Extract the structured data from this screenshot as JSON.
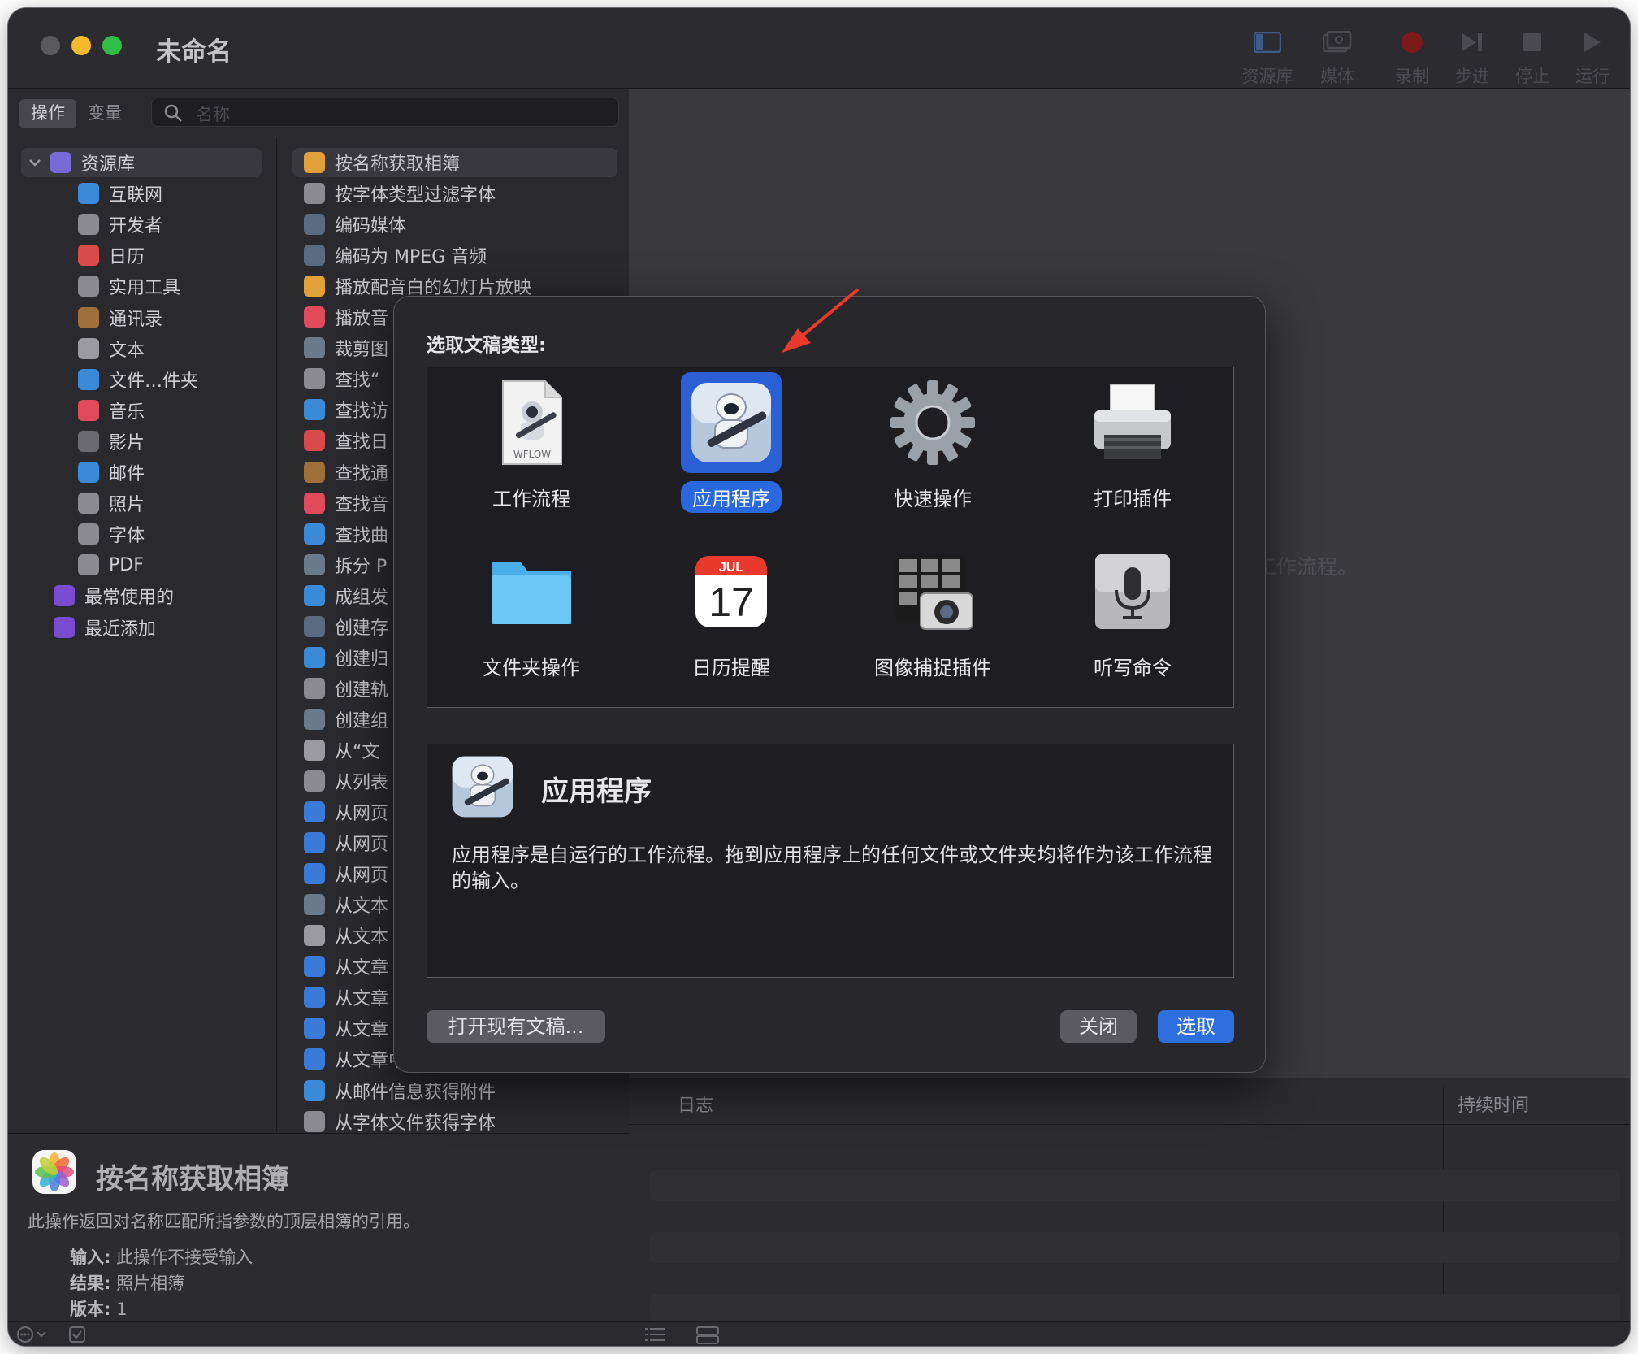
{
  "window": {
    "title": "未命名"
  },
  "toolbar": {
    "buttons": [
      {
        "label": "资源库",
        "icon": "sidebar-icon"
      },
      {
        "label": "媒体",
        "icon": "media-icon"
      },
      {
        "label": "录制",
        "icon": "record-icon"
      },
      {
        "label": "步进",
        "icon": "step-icon"
      },
      {
        "label": "停止",
        "icon": "stop-icon"
      },
      {
        "label": "运行",
        "icon": "play-icon"
      }
    ]
  },
  "library": {
    "segments": [
      "操作",
      "变量"
    ],
    "search_placeholder": "名称",
    "categories": [
      {
        "label": "资源库",
        "icon": "library-icon",
        "color": "#7a6ad8"
      },
      {
        "label": "互联网",
        "icon": "globe-icon",
        "color": "#3a8ad8"
      },
      {
        "label": "开发者",
        "icon": "tools-icon",
        "color": "#8a8a90"
      },
      {
        "label": "日历",
        "icon": "calendar-icon",
        "color": "#d84a4a"
      },
      {
        "label": "实用工具",
        "icon": "utilities-icon",
        "color": "#8a8a90"
      },
      {
        "label": "通讯录",
        "icon": "contacts-icon",
        "color": "#a0703a"
      },
      {
        "label": "文本",
        "icon": "text-icon",
        "color": "#9a9aa0"
      },
      {
        "label": "文件…件夹",
        "icon": "finder-icon",
        "color": "#3a8ad8"
      },
      {
        "label": "音乐",
        "icon": "music-icon",
        "color": "#e04a5a"
      },
      {
        "label": "影片",
        "icon": "movie-icon",
        "color": "#6a6a70"
      },
      {
        "label": "邮件",
        "icon": "mail-icon",
        "color": "#3a8ad8"
      },
      {
        "label": "照片",
        "icon": "photos-icon",
        "color": "#8a8a90"
      },
      {
        "label": "字体",
        "icon": "font-icon",
        "color": "#8a8a90"
      },
      {
        "label": "PDF",
        "icon": "pdf-icon",
        "color": "#8a8a90"
      },
      {
        "label": "最常使用的",
        "icon": "smart-folder-icon",
        "color": "#7a4ad0"
      },
      {
        "label": "最近添加",
        "icon": "smart-folder-icon",
        "color": "#7a4ad0"
      }
    ],
    "actions": [
      "按名称获取相簿",
      "按字体类型过滤字体",
      "编码媒体",
      "编码为 MPEG 音频",
      "播放配音白的幻灯片放映",
      "播放音",
      "裁剪图",
      "查找“",
      "查找访",
      "查找日",
      "查找通",
      "查找音",
      "查找曲",
      "拆分 P",
      "成组发",
      "创建存",
      "创建归",
      "创建轨",
      "创建组",
      "从“文",
      "从列表",
      "从网页",
      "从网页",
      "从网页",
      "从文本",
      "从文本",
      "从文章",
      "从文章",
      "从文章",
      "从文章中获得URL",
      "从邮件信息获得附件",
      "从字体文件获得字体"
    ],
    "action_colors": [
      "#e0a03a",
      "#8a8a90",
      "#5a6a80",
      "#5a6a80",
      "#e0a03a",
      "#e04a5a",
      "#6a7a8a",
      "#8a8a90",
      "#3a8ad8",
      "#d84a4a",
      "#a0703a",
      "#e04a5a",
      "#3a8ad8",
      "#6a7a8a",
      "#3a8ad8",
      "#5a6a80",
      "#3a8ad8",
      "#8a8a90",
      "#6a7a8a",
      "#9a9aa0",
      "#8a8a90",
      "#3a7ad8",
      "#3a7ad8",
      "#3a7ad8",
      "#6a7a8a",
      "#9a9aa0",
      "#3a7ad8",
      "#3a7ad8",
      "#3a7ad8",
      "#3a7ad8",
      "#3a8ad8",
      "#8a8a90"
    ]
  },
  "description": {
    "title": "按名称获取相簿",
    "text": "此操作返回对名称匹配所指参数的顶层相簿的引用。",
    "input_label": "输入:",
    "input_value": "此操作不接受输入",
    "result_label": "结果:",
    "result_value": "照片相簿",
    "version_label": "版本:",
    "version_value": "1"
  },
  "workflow": {
    "hint": "工作流程。"
  },
  "log": {
    "col_log": "日志",
    "col_duration": "持续时间"
  },
  "dialog": {
    "title": "选取文稿类型:",
    "types": [
      {
        "label": "工作流程",
        "icon": "wflow-document-icon",
        "badge": "WFLOW",
        "selected": false
      },
      {
        "label": "应用程序",
        "icon": "automator-robot-icon",
        "selected": true
      },
      {
        "label": "快速操作",
        "icon": "gear-icon",
        "selected": false
      },
      {
        "label": "打印插件",
        "icon": "printer-icon",
        "selected": false
      },
      {
        "label": "文件夹操作",
        "icon": "folder-icon",
        "selected": false
      },
      {
        "label": "日历提醒",
        "icon": "calendar-icon",
        "month": "JUL",
        "day": "17",
        "selected": false
      },
      {
        "label": "图像捕捉插件",
        "icon": "camera-icon",
        "selected": false
      },
      {
        "label": "听写命令",
        "icon": "microphone-icon",
        "selected": false
      }
    ],
    "info_title": "应用程序",
    "info_text": "应用程序是自运行的工作流程。拖到应用程序上的任何文件或文件夹均将作为该工作流程的输入。",
    "open_button": "打开现有文稿...",
    "close_button": "关闭",
    "choose_button": "选取"
  },
  "colors": {
    "accent": "#2e6fe0",
    "selection": "#2a5fd6",
    "annotation_arrow": "#e8392c"
  }
}
